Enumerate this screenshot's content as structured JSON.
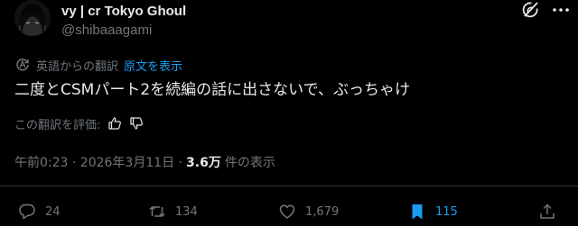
{
  "author": {
    "display_name": "vy | cr Tokyo Ghoul",
    "handle": "@shibaaagami"
  },
  "translation": {
    "label": "英語からの翻訳",
    "show_original": "原文を表示"
  },
  "tweet": {
    "text": "二度とCSMパート2を続編の話に出さないで、ぶっちゃけ"
  },
  "rate_translation": {
    "label": "この翻訳を評価:"
  },
  "meta": {
    "time": "午前0:23 · 2026年3月11日 ·",
    "views": "3.6万",
    "views_suffix": "件の表示"
  },
  "actions": {
    "replies": "24",
    "reposts": "134",
    "likes": "1,679",
    "bookmarks": "115"
  },
  "colors": {
    "background": "#000000",
    "text": "#e7e9ea",
    "secondary": "#71767b",
    "accent": "#1d9bf0"
  },
  "icons": [
    "grok-icon",
    "more-icon",
    "translate-icon",
    "thumbs-up-icon",
    "thumbs-down-icon",
    "reply-icon",
    "repost-icon",
    "like-icon",
    "bookmark-icon",
    "share-icon"
  ]
}
